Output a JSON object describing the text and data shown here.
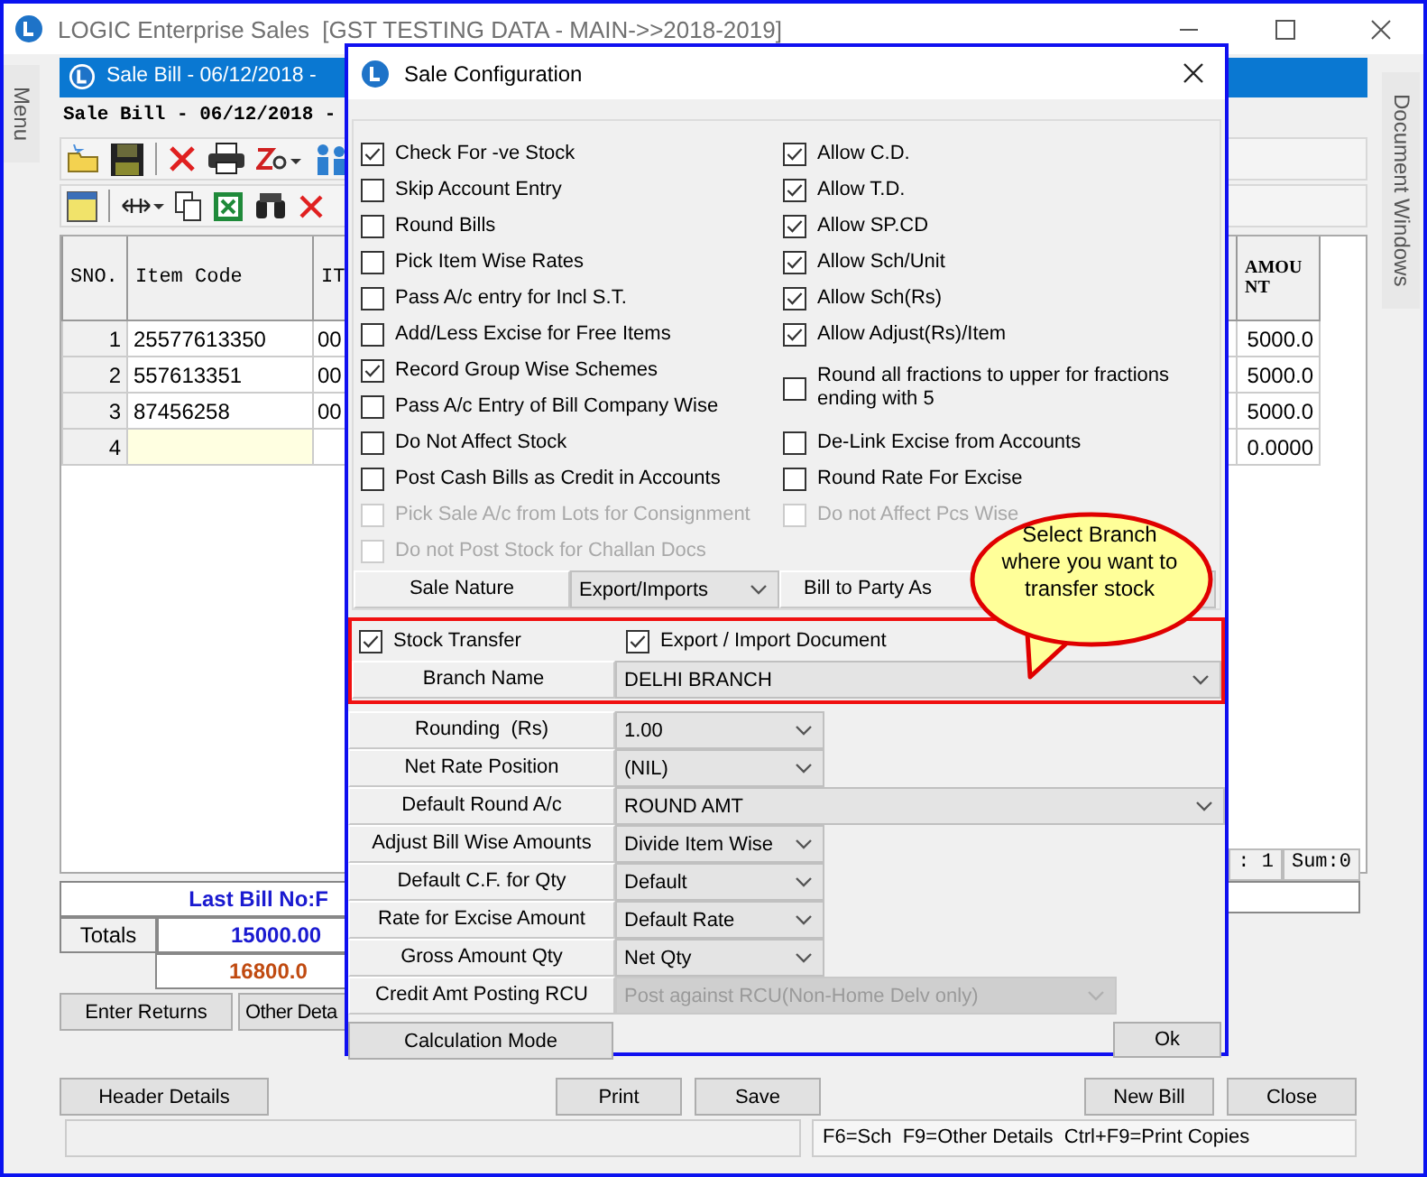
{
  "window": {
    "title": "LOGIC Enterprise Sales  [GST TESTING DATA - MAIN->>2018-2019]"
  },
  "side_tabs": {
    "left": "Menu",
    "right": "Document Windows"
  },
  "document": {
    "title": "Sale Bill - 06/12/2018 -",
    "heading": "Sale Bill - 06/12/2018 -",
    "grid": {
      "columns": [
        {
          "label": "SNO."
        },
        {
          "label": "Item Code"
        },
        {
          "label": "IT"
        },
        {
          "label": "AMOUNT"
        }
      ],
      "rows": [
        {
          "sno": "1",
          "item_code": "25577613350",
          "column_3": "00",
          "amount": "5000.0",
          "selected": false
        },
        {
          "sno": "2",
          "item_code": "557613351",
          "column_3": "00",
          "amount": "5000.0",
          "selected": false
        },
        {
          "sno": "3",
          "item_code": "87456258",
          "column_3": "00",
          "amount": "5000.0",
          "selected": false
        },
        {
          "sno": "4",
          "amount": "0.0000",
          "selected": true
        }
      ]
    },
    "count": ": 1",
    "sum": "Sum:0",
    "last_bill": "Last Bill No:F",
    "totals_label": "Totals",
    "total_1": "15000.00",
    "total_2": "16800.0",
    "buttons_row_1": [
      "Enter Returns",
      "Other Deta"
    ],
    "buttons_left": [
      "Header Details"
    ],
    "buttons_middle": [
      "Print",
      "Save"
    ],
    "buttons_right": [
      "New Bill",
      "Close"
    ],
    "status": "F6=Sch  F9=Other Details  Ctrl+F9=Print Copies"
  },
  "dialog": {
    "title": "Sale Configuration",
    "left_options": [
      {
        "label": "Check For -ve Stock",
        "checked": true,
        "disabled": false
      },
      {
        "label": "Skip Account Entry",
        "checked": false,
        "disabled": false
      },
      {
        "label": "Round Bills",
        "checked": false,
        "disabled": false
      },
      {
        "label": "Pick Item Wise Rates",
        "checked": false,
        "disabled": false
      },
      {
        "label": "Pass A/c entry for Incl S.T.",
        "checked": false,
        "disabled": false
      },
      {
        "label": "Add/Less Excise for Free Items",
        "checked": false,
        "disabled": false
      },
      {
        "label": "Record Group Wise Schemes",
        "checked": true,
        "disabled": false
      },
      {
        "label": "Pass A/c Entry of Bill Company Wise",
        "checked": false,
        "disabled": false
      },
      {
        "label": "Do Not Affect Stock",
        "checked": false,
        "disabled": false
      },
      {
        "label": "Post Cash Bills as Credit in Accounts",
        "checked": false,
        "disabled": false
      },
      {
        "label": "Pick Sale A/c from Lots for Consignment",
        "checked": false,
        "disabled": true
      },
      {
        "label": "Do not Post Stock for Challan Docs",
        "checked": false,
        "disabled": true
      }
    ],
    "right_options": [
      {
        "label": "Allow C.D.",
        "checked": true,
        "disabled": false
      },
      {
        "label": "Allow T.D.",
        "checked": true,
        "disabled": false
      },
      {
        "label": "Allow SP.CD",
        "checked": true,
        "disabled": false
      },
      {
        "label": "Allow Sch/Unit",
        "checked": true,
        "disabled": false
      },
      {
        "label": "Allow Sch(Rs)",
        "checked": true,
        "disabled": false
      },
      {
        "label": "Allow Adjust(Rs)/Item",
        "checked": true,
        "disabled": false
      },
      {
        "label": "Round all fractions to upper for fractions ending with 5",
        "checked": false,
        "disabled": false
      },
      {
        "label": "De-Link Excise from Accounts",
        "checked": false,
        "disabled": false
      },
      {
        "label": "Round Rate For Excise",
        "checked": false,
        "disabled": false
      },
      {
        "label": "Do not Affect Pcs Wise",
        "checked": false,
        "disabled": true
      }
    ],
    "sale_nature": {
      "label": "Sale Nature",
      "value": "Export/Imports"
    },
    "bill_to_party": {
      "label": "Bill to Party As"
    },
    "stock_transfer": {
      "label": "Stock Transfer",
      "checked": true
    },
    "export_import": {
      "label": "Export / Import Document",
      "checked": true
    },
    "fields": [
      {
        "label": "Branch Name",
        "value": "DELHI BRANCH",
        "disabled": false
      },
      {
        "label": "Rounding  (Rs)",
        "value": "1.00",
        "disabled": false
      },
      {
        "label": "Net Rate Position",
        "value": "(NIL)",
        "disabled": false
      },
      {
        "label": "Default Round A/c",
        "value": "ROUND AMT",
        "disabled": false
      },
      {
        "label": "Adjust Bill Wise Amounts",
        "value": "Divide Item Wise",
        "disabled": false
      },
      {
        "label": "Default C.F. for Qty",
        "value": "Default",
        "disabled": false
      },
      {
        "label": "Rate for Excise Amount",
        "value": "Default Rate",
        "disabled": false
      },
      {
        "label": "Gross Amount Qty",
        "value": "Net Qty",
        "disabled": false
      },
      {
        "label": "Credit Amt Posting RCU",
        "value": "Post against RCU(Non-Home Delv only)",
        "disabled": true
      }
    ],
    "calc_button": "Calculation Mode",
    "ok_button": "Ok"
  },
  "callout": "Select Branch where you want to transfer stock"
}
